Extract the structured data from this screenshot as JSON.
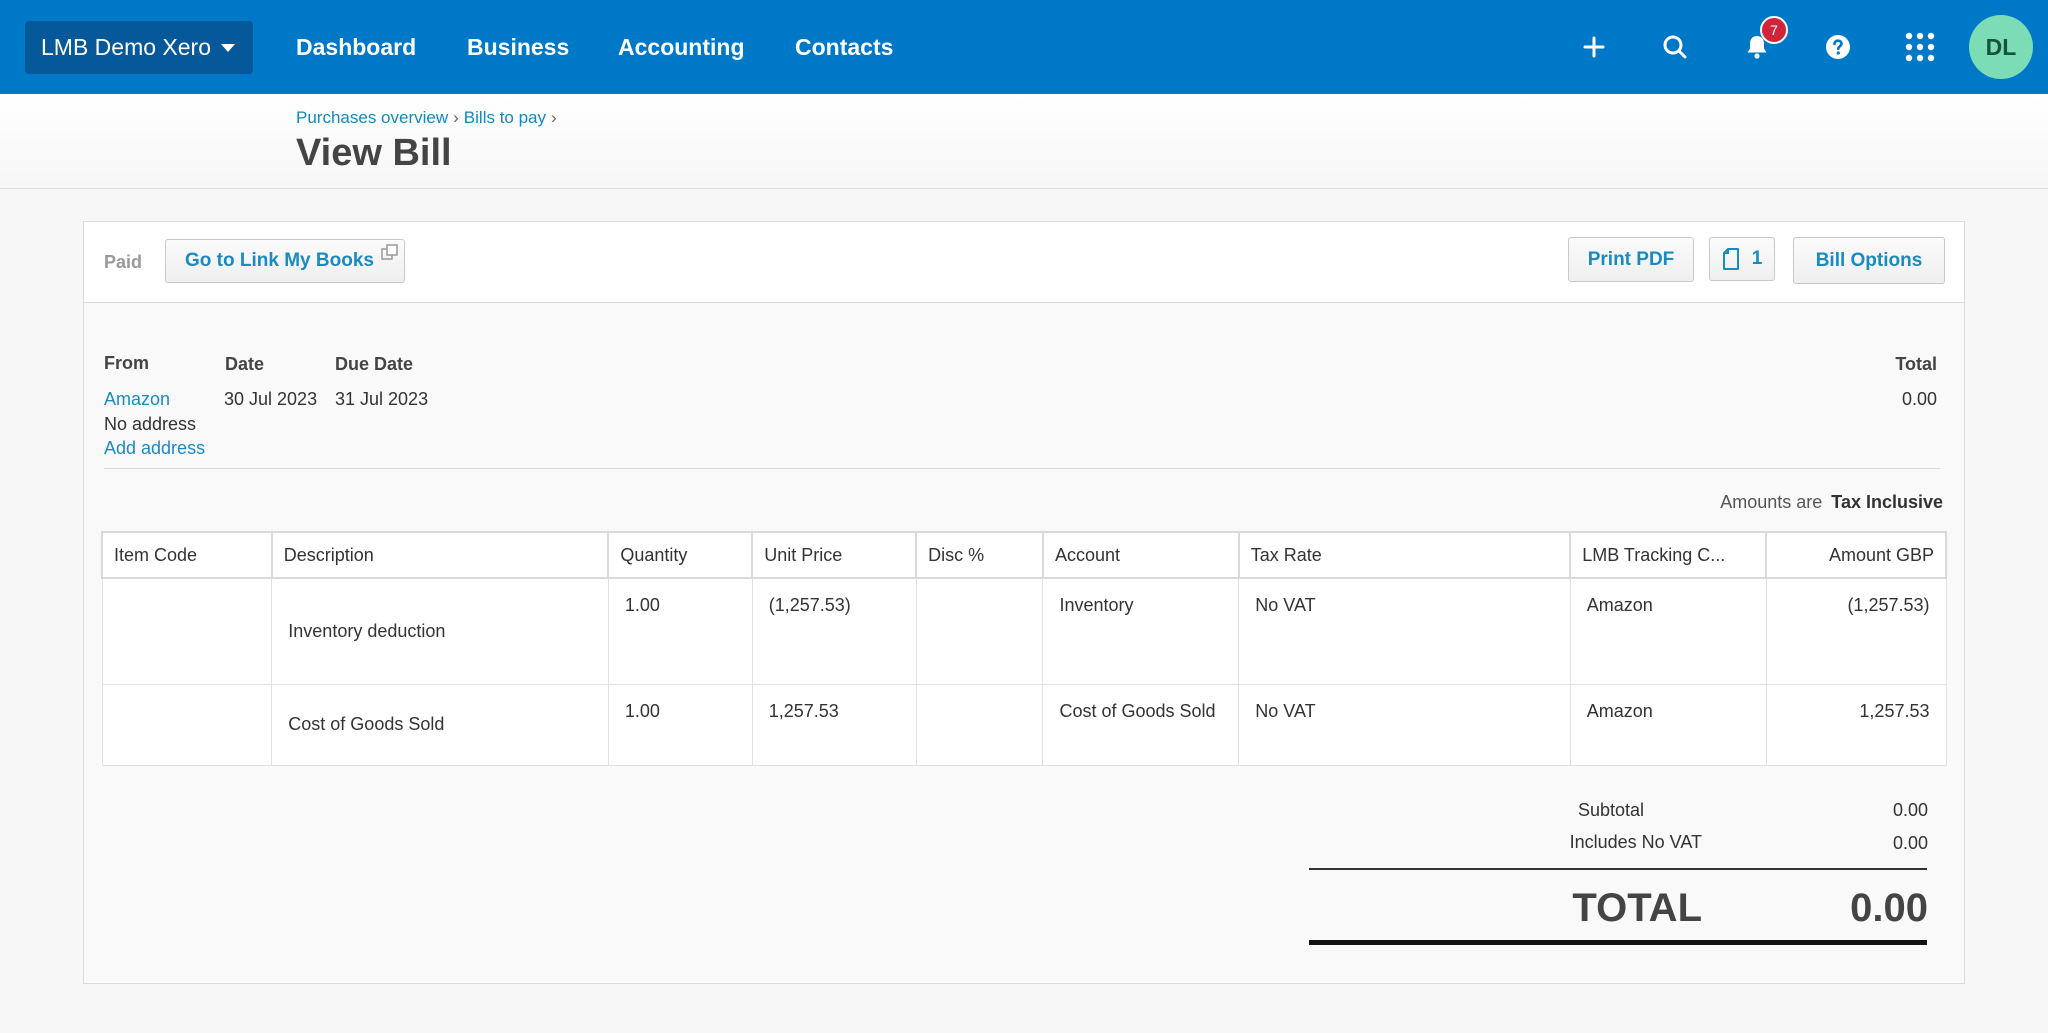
{
  "nav": {
    "org_name": "LMB Demo Xero",
    "items": [
      "Dashboard",
      "Business",
      "Accounting",
      "Contacts"
    ],
    "notification_count": "7",
    "user_initials": "DL",
    "icons": [
      "plus-icon",
      "search-icon",
      "bell-icon",
      "help-icon",
      "apps-grid-icon"
    ]
  },
  "breadcrumb": {
    "items": [
      "Purchases overview",
      "Bills to pay"
    ],
    "separator": "›"
  },
  "page": {
    "title": "View Bill"
  },
  "toolbar": {
    "status": "Paid",
    "link_button": "Go to Link My Books",
    "print_button": "Print PDF",
    "attachments_count": "1",
    "options_button": "Bill Options"
  },
  "bill": {
    "from_label": "From",
    "date_label": "Date",
    "due_label": "Due Date",
    "total_label": "Total",
    "from": "Amazon",
    "address": "No address",
    "add_address": "Add address",
    "date": "30 Jul 2023",
    "due_date": "31 Jul 2023",
    "total": "0.00",
    "amounts_are_label": "Amounts are",
    "amounts_are_value": "Tax Inclusive"
  },
  "table": {
    "headers": [
      "Item Code",
      "Description",
      "Quantity",
      "Unit Price",
      "Disc %",
      "Account",
      "Tax Rate",
      "LMB Tracking C...",
      "Amount GBP"
    ],
    "rows": [
      {
        "item_code": "",
        "description": "Inventory deduction",
        "quantity": "1.00",
        "unit_price": "(1,257.53)",
        "disc": "",
        "account": "Inventory",
        "tax_rate": "No VAT",
        "tracking": "Amazon",
        "amount": "(1,257.53)"
      },
      {
        "item_code": "",
        "description": "Cost of Goods Sold",
        "quantity": "1.00",
        "unit_price": "1,257.53",
        "disc": "",
        "account": "Cost of Goods Sold",
        "tax_rate": "No VAT",
        "tracking": "Amazon",
        "amount": "1,257.53"
      }
    ]
  },
  "totals": {
    "subtotal_label": "Subtotal",
    "subtotal": "0.00",
    "vat_label": "Includes No VAT",
    "vat": "0.00",
    "total_label": "TOTAL",
    "total": "0.00"
  }
}
